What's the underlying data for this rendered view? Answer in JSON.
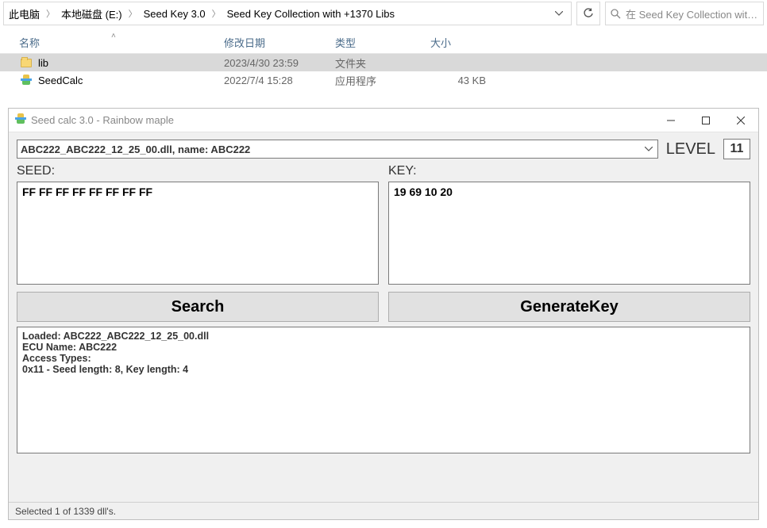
{
  "explorer": {
    "breadcrumb": [
      "此电脑",
      "本地磁盘 (E:)",
      "Seed Key 3.0",
      "Seed Key Collection with +1370 Libs"
    ],
    "refresh_tip": "↻",
    "search_placeholder": "在 Seed Key Collection wit…",
    "columns": {
      "name": "名称",
      "date": "修改日期",
      "type": "类型",
      "size": "大小"
    },
    "rows": [
      {
        "icon": "folder",
        "name": "lib",
        "date": "2023/4/30 23:59",
        "type": "文件夹",
        "size": "",
        "selected": true
      },
      {
        "icon": "app",
        "name": "SeedCalc",
        "date": "2022/7/4 15:28",
        "type": "应用程序",
        "size": "43 KB",
        "selected": false
      }
    ]
  },
  "app": {
    "title": "Seed calc 3.0 - Rainbow maple",
    "combo_value": "ABC222_ABC222_12_25_00.dll, name: ABC222",
    "level_label": "LEVEL",
    "level_value": "11",
    "seed_label": "SEED:",
    "seed_value": "FF FF FF FF FF FF FF FF",
    "key_label": "KEY:",
    "key_value": "19 69 10 20",
    "search_btn": "Search",
    "generate_btn": "GenerateKey",
    "log_text": "Loaded: ABC222_ABC222_12_25_00.dll\nECU Name: ABC222\nAccess Types:\n0x11 - Seed length: 8, Key length: 4",
    "status": "Selected 1 of 1339 dll's."
  }
}
